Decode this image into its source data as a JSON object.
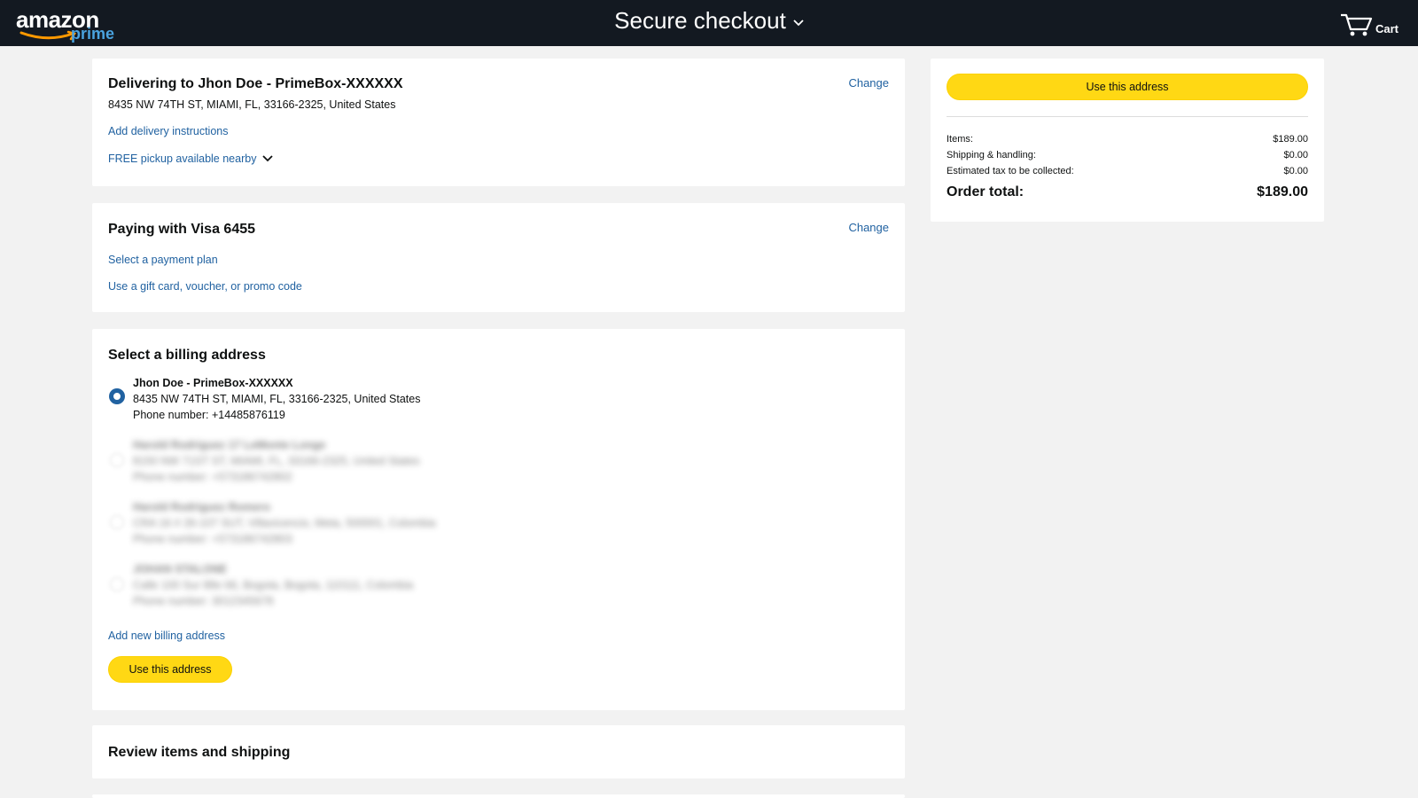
{
  "header": {
    "logo_text": "amazon",
    "logo_prime": "prime",
    "title": "Secure checkout",
    "cart_label": "Cart"
  },
  "delivery": {
    "title": "Delivering to Jhon Doe - PrimeBox-XXXXXX",
    "address": "8435 NW 74TH ST, MIAMI, FL, 33166-2325, United States",
    "change_label": "Change",
    "instructions_link": "Add delivery instructions",
    "pickup_link": "FREE pickup available nearby"
  },
  "payment": {
    "title": "Paying with Visa 6455",
    "change_label": "Change",
    "plan_link": "Select a payment plan",
    "gift_link": "Use a gift card, voucher, or promo code"
  },
  "billing": {
    "title": "Select a billing address",
    "addresses": [
      {
        "name": "Jhon Doe - PrimeBox-XXXXXX",
        "line": "8435 NW 74TH ST, MIAMI, FL, 33166-2325, United States",
        "phone": "Phone number: +14485876119",
        "selected": true
      },
      {
        "name": "Harold Rodriguez 17 LeMonte Longe",
        "line": "8150 NW 71ST ST, MIAMI, FL, 33166-2325, United States",
        "phone": "Phone number: +573186742802",
        "selected": false
      },
      {
        "name": "Harold Rodriguez Romero",
        "line": "CRA 16 # 26-107 SUT, Villavicencio, Meta, 500001, Colombia",
        "phone": "Phone number: +573186742803",
        "selected": false
      },
      {
        "name": "JOHAN STALONE",
        "line": "Calle 100 Sur 88e 66, Bogota, Bogota, 110111, Colombia",
        "phone": "Phone number: 3012345678",
        "selected": false
      }
    ],
    "add_link": "Add new billing address",
    "use_button": "Use this address"
  },
  "review": {
    "title": "Review items and shipping"
  },
  "summary": {
    "use_button": "Use this address",
    "items_label": "Items:",
    "items_value": "$189.00",
    "shipping_label": "Shipping & handling:",
    "shipping_value": "$0.00",
    "tax_label": "Estimated tax to be collected:",
    "tax_value": "$0.00",
    "total_label": "Order total:",
    "total_value": "$189.00"
  },
  "colors": {
    "header_bg": "#131921",
    "link": "#2162a1",
    "button_yellow": "#ffd814",
    "page_bg": "#f2f2f2"
  }
}
